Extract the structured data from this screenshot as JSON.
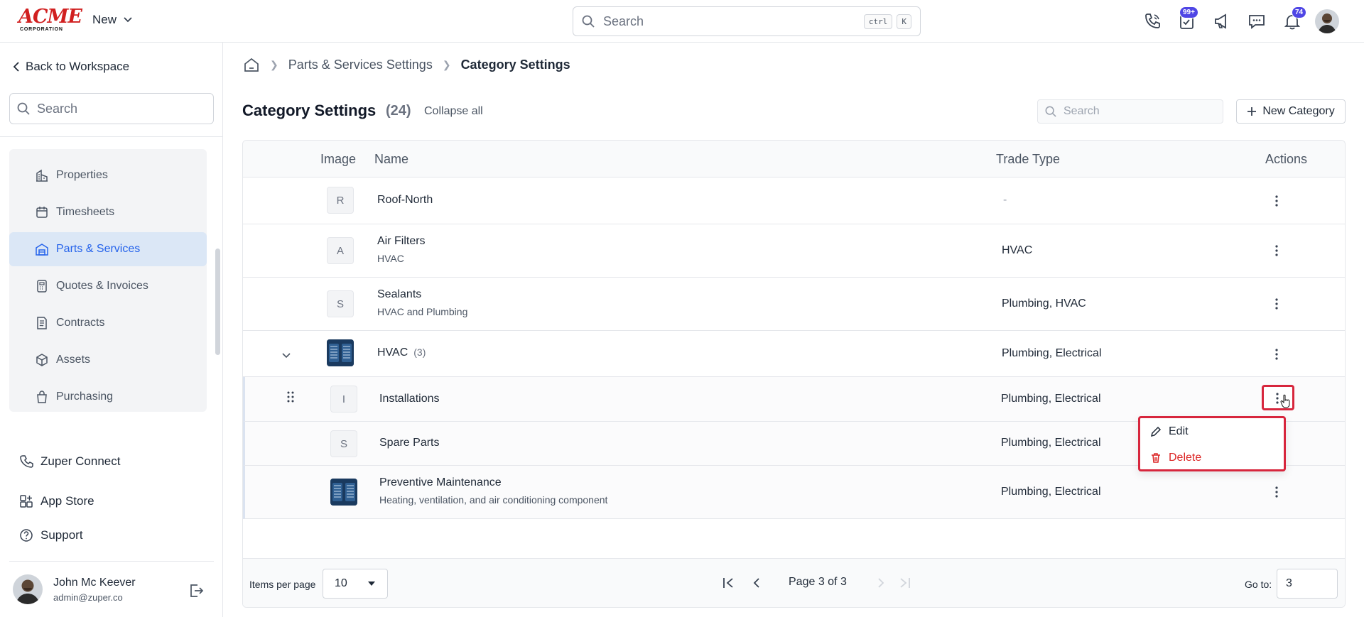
{
  "header": {
    "logo_text": "ACME",
    "logo_sub": "CORPORATION",
    "new_label": "New",
    "search_placeholder": "Search",
    "kbd_1": "ctrl",
    "kbd_2": "K",
    "tasks_badge": "99+",
    "notifications_badge": "74",
    "icons": [
      "phone-icon",
      "tasks-icon",
      "megaphone-icon",
      "chat-icon",
      "bell-icon",
      "avatar"
    ]
  },
  "sidebar": {
    "back_label": "Back to Workspace",
    "search_placeholder": "Search",
    "items": [
      {
        "label": "Properties",
        "icon": "building-icon"
      },
      {
        "label": "Timesheets",
        "icon": "calendar-icon"
      },
      {
        "label": "Parts & Services",
        "icon": "warehouse-icon",
        "active": true
      },
      {
        "label": "Quotes & Invoices",
        "icon": "calculator-icon"
      },
      {
        "label": "Contracts",
        "icon": "contract-icon"
      },
      {
        "label": "Assets",
        "icon": "box-icon"
      },
      {
        "label": "Purchasing",
        "icon": "shopping-bag-icon"
      }
    ],
    "links": [
      {
        "label": "Zuper Connect",
        "icon": "phone-icon"
      },
      {
        "label": "App Store",
        "icon": "app-store-icon"
      },
      {
        "label": "Support",
        "icon": "help-icon"
      }
    ],
    "user": {
      "name": "John Mc Keever",
      "email": "admin@zuper.co"
    }
  },
  "breadcrumb": {
    "home_icon": "home-icon",
    "items": [
      "Parts & Services Settings",
      "Category Settings"
    ]
  },
  "page": {
    "title": "Category Settings",
    "count": "(24)",
    "collapse_all": "Collapse all",
    "search_placeholder": "Search",
    "new_category": "New Category"
  },
  "table": {
    "columns": [
      "Image",
      "Name",
      "Trade Type",
      "Actions"
    ],
    "rows": [
      {
        "letter": "R",
        "name": "Roof-North",
        "sub": "",
        "trade": "-"
      },
      {
        "letter": "A",
        "name": "Air Filters",
        "sub": "HVAC",
        "trade": "HVAC"
      },
      {
        "letter": "S",
        "name": "Sealants",
        "sub": "HVAC and Plumbing",
        "trade": "Plumbing, HVAC"
      },
      {
        "letter": "",
        "name": "HVAC",
        "count": "(3)",
        "sub": "",
        "trade": "Plumbing, Electrical",
        "expanded": true
      },
      {
        "letter": "I",
        "name": "Installations",
        "sub": "",
        "trade": "Plumbing, Electrical",
        "child": true
      },
      {
        "letter": "S",
        "name": "Spare Parts",
        "sub": "",
        "trade": "Plumbing, Electrical",
        "child": true
      },
      {
        "letter": "",
        "name": "Preventive Maintenance",
        "sub": "Heating, ventilation, and air conditioning component",
        "trade": "Plumbing, Electrical",
        "child": true
      }
    ]
  },
  "context_menu": {
    "edit": "Edit",
    "delete": "Delete"
  },
  "pagination": {
    "items_per_page_label": "Items per page",
    "items_per_page": "10",
    "page_text": "Page 3 of 3",
    "goto_label": "Go to:",
    "goto_value": "3"
  },
  "colors": {
    "accent": "#2563eb",
    "danger": "#dc2626",
    "highlight": "#d7263d",
    "brand": "#d12020"
  }
}
